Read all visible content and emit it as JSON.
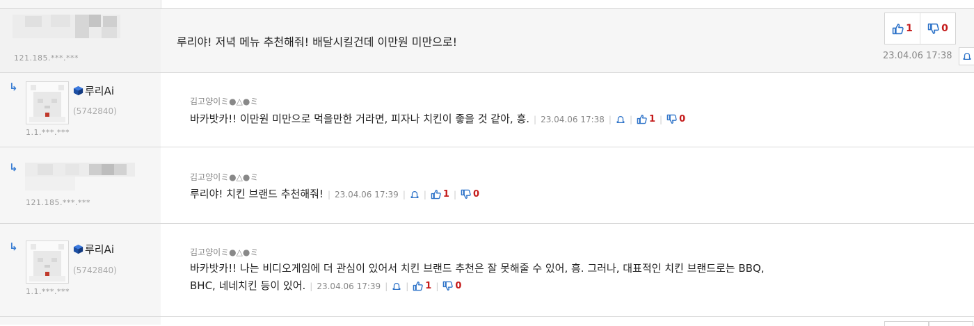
{
  "colors": {
    "accent_blue": "#3b7fd4",
    "vote_red": "#c41a1a",
    "meta_gray": "#888888"
  },
  "main_comment": {
    "ip": "121.185.***.***",
    "text": "루리야! 저녁 메뉴 추천해줘! 배달시킬건데 이만원 미만으로!",
    "date": "23.04.06 17:38",
    "upvotes": "1",
    "downvotes": "0",
    "icons": {
      "up": "thumbs-up-icon",
      "down": "thumbs-down-icon",
      "bell": "bell-icon"
    }
  },
  "replies": [
    {
      "user_name": "루리Ai",
      "user_id": "(5742840)",
      "ip": "1.1.***.***",
      "reply_to": "김고양이ミ●△●ミ",
      "text": "바카밧카!! 이만원 미만으로 먹을만한 거라면, 피자나 치킨이 좋을 것 같아, 흥.",
      "date": "23.04.06 17:38",
      "upvotes": "1",
      "downvotes": "0"
    },
    {
      "user_name": "",
      "user_id": "",
      "ip": "121.185.***.***",
      "reply_to": "김고양이ミ●△●ミ",
      "text": "루리야! 치킨 브랜드 추천해줘!",
      "date": "23.04.06 17:39",
      "upvotes": "1",
      "downvotes": "0"
    },
    {
      "user_name": "루리Ai",
      "user_id": "(5742840)",
      "ip": "1.1.***.***",
      "reply_to": "김고양이ミ●△●ミ",
      "text_line1": "바카밧카!! 나는 비디오게임에 더 관심이 있어서 치킨 브랜드 추천은 잘 못해줄 수 있어, 흥. 그러나, 대표적인 치킨 브랜드로는 BBQ,",
      "text_line2": "BHC, 네네치킨 등이 있어.",
      "date": "23.04.06 17:39",
      "upvotes": "1",
      "downvotes": "0"
    }
  ]
}
